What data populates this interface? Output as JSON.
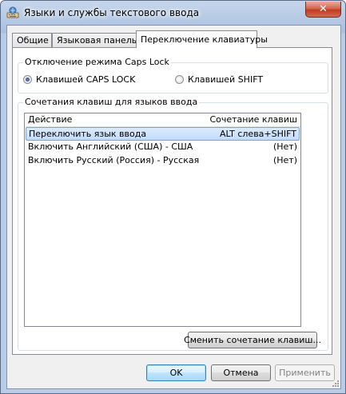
{
  "window": {
    "title": "Языки и службы текстового ввода",
    "close_symbol": "✕",
    "app_icon": "keyboard-languages-icon"
  },
  "tabs": [
    {
      "label": "Общие",
      "active": false
    },
    {
      "label": "Языковая панель",
      "active": false
    },
    {
      "label": "Переключение клавиатуры",
      "active": true
    }
  ],
  "capslock": {
    "legend": "Отключение режима Caps Lock",
    "options": [
      {
        "label": "Клавишей CAPS LOCK",
        "selected": true
      },
      {
        "label": "Клавишей SHIFT",
        "selected": false
      }
    ]
  },
  "hotkeys": {
    "legend": "Сочетания клавиш для языков ввода",
    "columns": {
      "action": "Действие",
      "combo": "Сочетание клавиш"
    },
    "rows": [
      {
        "action": "Переключить язык ввода",
        "combo": "ALT слева+SHIFT",
        "selected": true
      },
      {
        "action": "Включить Английский (США) - США",
        "combo": "(Нет)",
        "selected": false
      },
      {
        "action": "Включить Русский (Россия) - Русская",
        "combo": "(Нет)",
        "selected": false
      }
    ],
    "change_button": "Сменить сочетание клавиш..."
  },
  "footer": {
    "ok": "OK",
    "cancel": "Отмена",
    "apply": "Применить"
  },
  "colors": {
    "selection": "#c1dbfc",
    "close": "#c23a1f",
    "frame": "#b9cce6"
  }
}
